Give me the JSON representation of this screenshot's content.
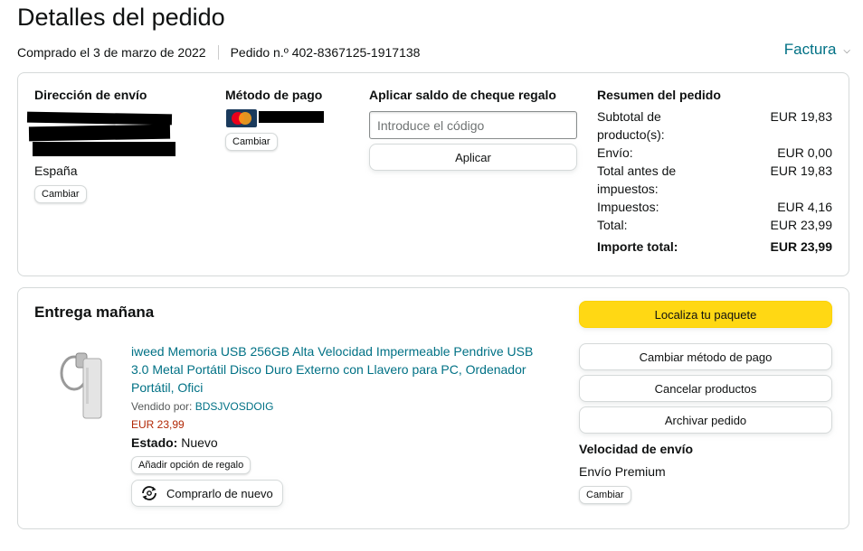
{
  "header": {
    "title": "Detalles del pedido",
    "purchased": "Comprado el 3 de marzo de 2022",
    "order_number": "Pedido n.º 402-8367125-1917138",
    "invoice_label": "Factura",
    "invoice_icon": "chevron-down-icon"
  },
  "shipping": {
    "heading": "Dirección de envío",
    "country": "España",
    "change_label": "Cambiar"
  },
  "payment": {
    "heading": "Método de pago",
    "card_icon": "mastercard-icon",
    "change_label": "Cambiar"
  },
  "gift_card": {
    "heading": "Aplicar saldo de cheque regalo",
    "input_placeholder": "Introduce el código",
    "apply_label": "Aplicar"
  },
  "summary": {
    "heading": "Resumen del pedido",
    "rows": [
      {
        "label": "Subtotal de producto(s):",
        "value": "EUR 19,83"
      },
      {
        "label": "Envío:",
        "value": "EUR 0,00"
      },
      {
        "label": "Total antes de impuestos:",
        "value": "EUR 19,83"
      },
      {
        "label": "Impuestos:",
        "value": "EUR 4,16"
      },
      {
        "label": "Total:",
        "value": "EUR 23,99"
      }
    ],
    "grand_total_label": "Importe total:",
    "grand_total_value": "EUR 23,99"
  },
  "delivery": {
    "title": "Entrega mañana",
    "product_title": "iweed Memoria USB 256GB Alta Velocidad Impermeable Pendrive USB 3.0 Metal Portátil Disco Duro Externo con Llavero para PC, Ordenador Portátil, Ofici",
    "sold_by_label": "Vendido por:",
    "seller": "BDSJVOSDOIG",
    "price": "EUR 23,99",
    "state_label": "Estado:",
    "state_value": "Nuevo",
    "gift_option_label": "Añadir opción de regalo",
    "buy_again_label": "Comprarlo de nuevo",
    "buy_again_icon": "buy-again-icon"
  },
  "actions": {
    "track": "Localiza tu paquete",
    "change_payment": "Cambiar método de pago",
    "cancel": "Cancelar productos",
    "archive": "Archivar pedido"
  },
  "shipping_speed": {
    "heading": "Velocidad de envío",
    "value": "Envío Premium",
    "change_label": "Cambiar"
  },
  "colors": {
    "link": "#007185",
    "price": "#b12704",
    "primary_button": "#ffd814",
    "border": "#d5d9d9"
  }
}
